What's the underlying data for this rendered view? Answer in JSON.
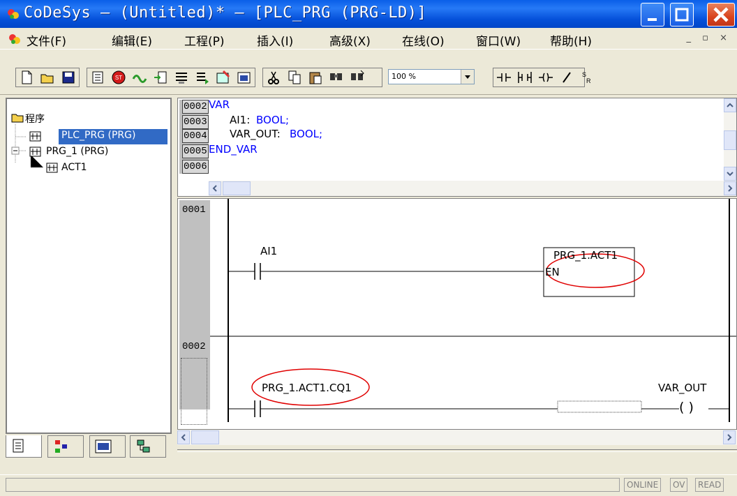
{
  "window": {
    "title": "CoDeSys – (Untitled)* – [PLC_PRG (PRG-LD)]"
  },
  "menu": [
    {
      "label": "文件(F)"
    },
    {
      "label": "编辑(E)"
    },
    {
      "label": "工程(P)"
    },
    {
      "label": "插入(I)"
    },
    {
      "label": "高级(X)"
    },
    {
      "label": "在线(O)"
    },
    {
      "label": "窗口(W)"
    },
    {
      "label": "帮助(H)"
    }
  ],
  "toolbar": {
    "zoom_value": "100 %"
  },
  "tree": {
    "root": "程序",
    "items": [
      {
        "label": "PLC_PRG (PRG)",
        "selected": true
      },
      {
        "label": "PRG_1 (PRG)"
      },
      {
        "label": "ACT1"
      }
    ]
  },
  "decl": {
    "lines": [
      {
        "num": "0002",
        "text": "VAR"
      },
      {
        "num": "0003",
        "name": "AI1:",
        "type": "BOOL;"
      },
      {
        "num": "0004",
        "name": "VAR_OUT:",
        "type": "BOOL;"
      },
      {
        "num": "0005",
        "text": "END_VAR"
      },
      {
        "num": "0006",
        "text": ""
      }
    ]
  },
  "ladder": {
    "networks": [
      {
        "num": "0001",
        "contact": "AI1",
        "box_title": "PRG_1.ACT1",
        "box_input": "EN"
      },
      {
        "num": "0002",
        "contact": "PRG_1.ACT1.CQ1",
        "coil": "VAR_OUT",
        "coil_symbol": "( )"
      }
    ]
  },
  "status": {
    "flags": [
      "ONLINE",
      "OV",
      "READ"
    ]
  },
  "colors": {
    "title_blue": "#0a5fe8",
    "keyword_blue": "#0000ff",
    "highlight_red": "#e00000",
    "selection": "#316ac5"
  }
}
